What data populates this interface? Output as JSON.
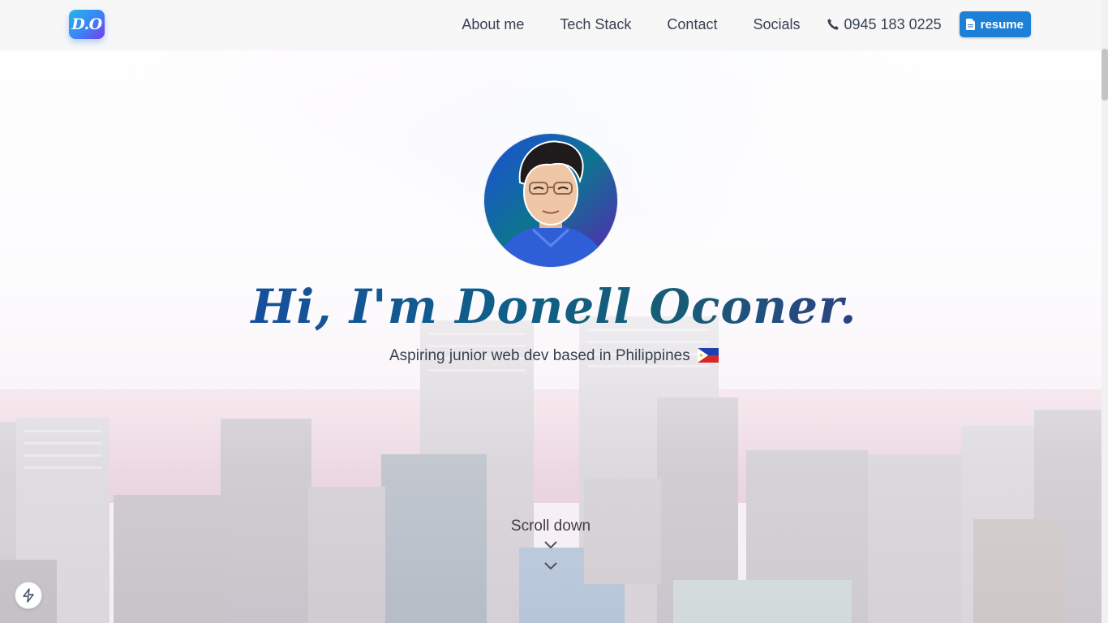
{
  "header": {
    "logo_text": "D.O",
    "nav": [
      {
        "label": "About me"
      },
      {
        "label": "Tech Stack"
      },
      {
        "label": "Contact"
      },
      {
        "label": "Socials"
      }
    ],
    "phone": "0945 183 0225",
    "resume_label": "resume"
  },
  "hero": {
    "title": "Hi, I'm Donell Oconer.",
    "subtitle": "Aspiring junior web dev based in Philippines",
    "scroll_label": "Scroll down"
  },
  "icons": {
    "phone": "phone-icon",
    "resume": "document-icon",
    "flag": "philippines-flag-icon",
    "chevron": "chevron-down-icon",
    "flash": "lightning-icon"
  },
  "colors": {
    "accent": "#1d7fd6",
    "title_gradient_start": "#1e40af",
    "title_gradient_end": "#4c1d95"
  }
}
